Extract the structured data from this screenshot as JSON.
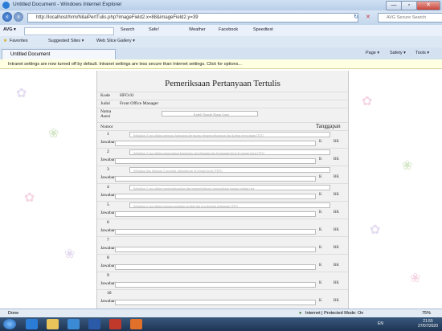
{
  "window": {
    "title": "Untitled Document - Windows Internet Explorer",
    "minimize": "—",
    "maximize": "▫",
    "close": "✕"
  },
  "address": {
    "url": "http://localhost/hrm/NilaiPertTulis.php?imageField2.x=88&imageField2.y=39",
    "search_placeholder": "AVG Secure Search"
  },
  "commands": [
    "AVG ▾",
    "Search",
    "Safe!",
    "Weather",
    "Facebook",
    "Speedtest"
  ],
  "favorites": {
    "label": "Favorites",
    "suggested": "Suggested Sites ▾",
    "gallery": "Web Slice Gallery ▾"
  },
  "tab": {
    "label": "Untitled Document"
  },
  "page_tools": [
    "Page ▾",
    "Safety ▾",
    "Tools ▾"
  ],
  "infobar": "Intranet settings are now turned off by default. Intranet settings are less secure than Internet settings. Click for options...",
  "form": {
    "title": "Pemeriksaan Pertanyaan Tertulis",
    "kode_label": "Kode",
    "kode_value": "HFO.01",
    "judul_label": "Judul",
    "judul_value": "Front Office Manager",
    "nama_label": "Nama Asesi",
    "nama_value": "Kadek Ngurah Bagus Gatot",
    "nomor_label": "Nomor",
    "tanggapan_label": "Tanggapan",
    "jawaban_label": "Jawaban",
    "k_label": "K",
    "bk_label": "BK",
    "questions": [
      {
        "no": "1",
        "text": "Sebutkan 4 cara dalam menjaga hubungan kerjasama dengan pelanggan dan kolega perusahaan (TI1)"
      },
      {
        "no": "2",
        "text": "Sebutkan 3 cara dalam menerapkan kesehatan, keselamatan dan keamanan kerja di tempat kerja (TI2)"
      },
      {
        "no": "3",
        "text": "Sebutkan dan jelaskan 3 prosedur administrasi di tempat kerja (TI03)"
      },
      {
        "no": "4",
        "text": "Sebutkan 2 cara dalam mengembangkan dan memperbaharui pengetahuan tentang industri ser"
      },
      {
        "no": "5",
        "text": "Sebutkan 2 cara dalam mempromosikan produk dan jasa kepada pelanggan (TI5)"
      },
      {
        "no": "6",
        "text": ""
      },
      {
        "no": "7",
        "text": ""
      },
      {
        "no": "8",
        "text": ""
      },
      {
        "no": "9",
        "text": ""
      },
      {
        "no": "10",
        "text": ""
      }
    ]
  },
  "status": {
    "left": "Done",
    "zone": "Internet | Protected Mode: On",
    "zoom": "75%"
  },
  "clock": {
    "time": "21:55",
    "date": "27/07/2020"
  },
  "tray_lang": "EN"
}
